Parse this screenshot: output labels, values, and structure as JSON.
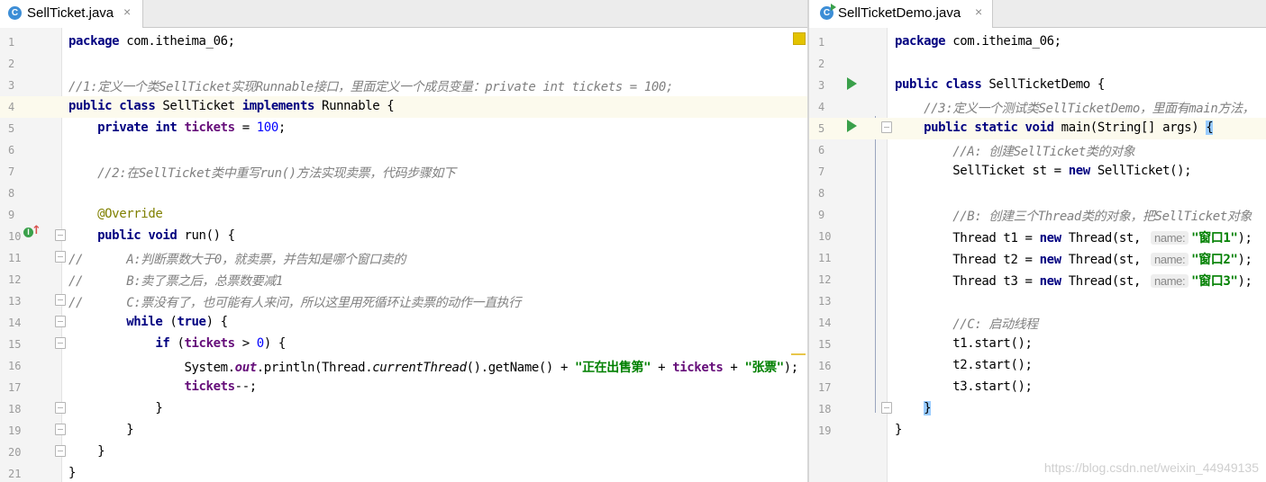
{
  "left_tab": {
    "title": "SellTicket.java",
    "icon_letter": "C",
    "close": "×"
  },
  "right_tab": {
    "title": "SellTicketDemo.java",
    "icon_letter": "C",
    "close": "×"
  },
  "left_editor": {
    "lines": [
      {
        "n": "1",
        "parts": [
          [
            "k",
            "package"
          ],
          [
            "p",
            " com.itheima_06;"
          ]
        ]
      },
      {
        "n": "2",
        "parts": []
      },
      {
        "n": "3",
        "parts": [
          [
            "c",
            "//1:定义一个类SellTicket实现Runnable接口，里面定义一个成员变量：private int tickets = 100;"
          ]
        ]
      },
      {
        "n": "4",
        "parts": [
          [
            "k",
            "public class"
          ],
          [
            "p",
            " SellTicket "
          ],
          [
            "k",
            "implements"
          ],
          [
            "p",
            " Runnable {"
          ]
        ]
      },
      {
        "n": "5",
        "parts": [
          [
            "p",
            "    "
          ],
          [
            "k",
            "private int"
          ],
          [
            "p",
            " "
          ],
          [
            "f",
            "tickets"
          ],
          [
            "p",
            " = "
          ],
          [
            "n",
            "100"
          ],
          [
            "p",
            ";"
          ]
        ]
      },
      {
        "n": "6",
        "parts": []
      },
      {
        "n": "7",
        "parts": [
          [
            "p",
            "    "
          ],
          [
            "c",
            "//2:在SellTicket类中重写run()方法实现卖票，代码步骤如下"
          ]
        ]
      },
      {
        "n": "8",
        "parts": []
      },
      {
        "n": "9",
        "parts": [
          [
            "p",
            "    "
          ],
          [
            "a",
            "@Override"
          ]
        ]
      },
      {
        "n": "10",
        "parts": [
          [
            "p",
            "    "
          ],
          [
            "k",
            "public void"
          ],
          [
            "p",
            " run() {"
          ]
        ]
      },
      {
        "n": "11",
        "parts": [
          [
            "c",
            "//      A:判断票数大于0，就卖票，并告知是哪个窗口卖的"
          ]
        ]
      },
      {
        "n": "12",
        "parts": [
          [
            "c",
            "//      B:卖了票之后，总票数要减1"
          ]
        ]
      },
      {
        "n": "13",
        "parts": [
          [
            "c",
            "//      C:票没有了，也可能有人来问，所以这里用死循环让卖票的动作一直执行"
          ]
        ]
      },
      {
        "n": "14",
        "parts": [
          [
            "p",
            "        "
          ],
          [
            "k",
            "while"
          ],
          [
            "p",
            " ("
          ],
          [
            "k",
            "true"
          ],
          [
            "p",
            ") {"
          ]
        ]
      },
      {
        "n": "15",
        "parts": [
          [
            "p",
            "            "
          ],
          [
            "k",
            "if"
          ],
          [
            "p",
            " ("
          ],
          [
            "f",
            "tickets"
          ],
          [
            "p",
            " > "
          ],
          [
            "n",
            "0"
          ],
          [
            "p",
            ") {"
          ]
        ]
      },
      {
        "n": "16",
        "parts": [
          [
            "p",
            "                System."
          ],
          [
            "st",
            "out"
          ],
          [
            "p",
            ".println(Thread."
          ],
          [
            "it",
            "currentThread"
          ],
          [
            "p",
            "().getName() + "
          ],
          [
            "s",
            "\"正在出售第\""
          ],
          [
            "p",
            " + "
          ],
          [
            "f",
            "tickets"
          ],
          [
            "p",
            " + "
          ],
          [
            "s",
            "\"张票\""
          ],
          [
            "p",
            ");"
          ]
        ]
      },
      {
        "n": "17",
        "parts": [
          [
            "p",
            "                "
          ],
          [
            "f",
            "tickets"
          ],
          [
            "p",
            "--;"
          ]
        ]
      },
      {
        "n": "18",
        "parts": [
          [
            "p",
            "            }"
          ]
        ]
      },
      {
        "n": "19",
        "parts": [
          [
            "p",
            "        }"
          ]
        ]
      },
      {
        "n": "20",
        "parts": [
          [
            "p",
            "    }"
          ]
        ]
      },
      {
        "n": "21",
        "parts": [
          [
            "p",
            "}"
          ]
        ]
      }
    ]
  },
  "right_editor": {
    "lines": [
      {
        "n": "1",
        "parts": [
          [
            "k",
            "package"
          ],
          [
            "p",
            " com.itheima_06;"
          ]
        ]
      },
      {
        "n": "2",
        "parts": []
      },
      {
        "n": "3",
        "parts": [
          [
            "k",
            "public class"
          ],
          [
            "p",
            " SellTicketDemo {"
          ]
        ]
      },
      {
        "n": "4",
        "parts": [
          [
            "p",
            "    "
          ],
          [
            "c",
            "//3:定义一个测试类SellTicketDemo，里面有main方法，"
          ]
        ]
      },
      {
        "n": "5",
        "parts": [
          [
            "p",
            "    "
          ],
          [
            "k",
            "public static void"
          ],
          [
            "p",
            " main(String[] args) "
          ],
          [
            "b",
            "{"
          ]
        ]
      },
      {
        "n": "6",
        "parts": [
          [
            "p",
            "        "
          ],
          [
            "c",
            "//A: 创建SellTicket类的对象"
          ]
        ]
      },
      {
        "n": "7",
        "parts": [
          [
            "p",
            "        SellTicket st = "
          ],
          [
            "k",
            "new"
          ],
          [
            "p",
            " SellTicket();"
          ]
        ]
      },
      {
        "n": "8",
        "parts": []
      },
      {
        "n": "9",
        "parts": [
          [
            "p",
            "        "
          ],
          [
            "c",
            "//B: 创建三个Thread类的对象，把SellTicket对象"
          ]
        ]
      },
      {
        "n": "10",
        "parts": [
          [
            "p",
            "        Thread t1 = "
          ],
          [
            "k",
            "new"
          ],
          [
            "p",
            " Thread(st, "
          ],
          [
            "h",
            "name:"
          ],
          [
            "s",
            "\"窗口1\""
          ],
          [
            "p",
            ");"
          ]
        ]
      },
      {
        "n": "11",
        "parts": [
          [
            "p",
            "        Thread t2 = "
          ],
          [
            "k",
            "new"
          ],
          [
            "p",
            " Thread(st, "
          ],
          [
            "h",
            "name:"
          ],
          [
            "s",
            "\"窗口2\""
          ],
          [
            "p",
            ");"
          ]
        ]
      },
      {
        "n": "12",
        "parts": [
          [
            "p",
            "        Thread t3 = "
          ],
          [
            "k",
            "new"
          ],
          [
            "p",
            " Thread(st, "
          ],
          [
            "h",
            "name:"
          ],
          [
            "s",
            "\"窗口3\""
          ],
          [
            "p",
            ");"
          ]
        ]
      },
      {
        "n": "13",
        "parts": []
      },
      {
        "n": "14",
        "parts": [
          [
            "p",
            "        "
          ],
          [
            "c",
            "//C: 启动线程"
          ]
        ]
      },
      {
        "n": "15",
        "parts": [
          [
            "p",
            "        t1.start();"
          ]
        ]
      },
      {
        "n": "16",
        "parts": [
          [
            "p",
            "        t2.start();"
          ]
        ]
      },
      {
        "n": "17",
        "parts": [
          [
            "p",
            "        t3.start();"
          ]
        ]
      },
      {
        "n": "18",
        "parts": [
          [
            "p",
            "    "
          ],
          [
            "b",
            "}"
          ]
        ]
      },
      {
        "n": "19",
        "parts": [
          [
            "p",
            "}"
          ]
        ]
      }
    ]
  },
  "watermark": "https://blog.csdn.net/weixin_44949135"
}
